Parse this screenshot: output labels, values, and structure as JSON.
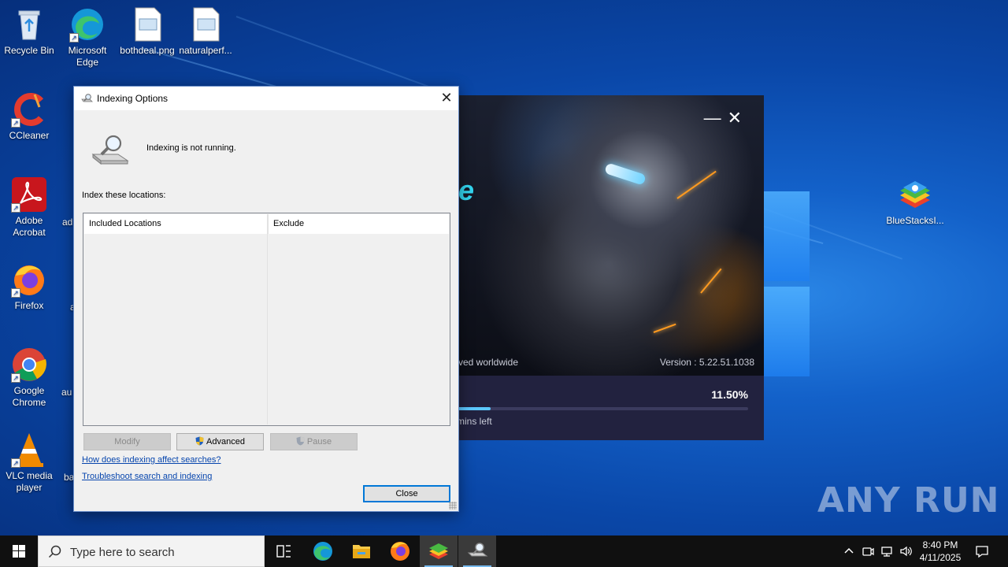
{
  "desktop": {
    "icons": [
      {
        "label": "Recycle Bin"
      },
      {
        "label": "Microsoft Edge"
      },
      {
        "label": "bothdeal.png"
      },
      {
        "label": "naturalperf..."
      },
      {
        "label": "CCleaner"
      },
      {
        "label": "Adobe Acrobat"
      },
      {
        "label": "Firefox"
      },
      {
        "label": "Google Chrome"
      },
      {
        "label": "VLC media player"
      },
      {
        "label": "BlueStacksI..."
      }
    ],
    "partial_labels": [
      "ad",
      "a",
      "au",
      "ba"
    ]
  },
  "bluestacks": {
    "rights_text": "rved worldwide",
    "version_text": "Version : 5.22.51.1038",
    "progress_text": "11.50%",
    "progress_value": 11.5,
    "time_left_text": "mins left",
    "logo_fragment": "e",
    "controls": {
      "minimize": "—",
      "close": "✕"
    }
  },
  "dialog": {
    "title": "Indexing Options",
    "status": "Indexing is not running.",
    "locations_label": "Index these locations:",
    "columns": [
      "Included Locations",
      "Exclude"
    ],
    "rows": [],
    "buttons": {
      "modify": "Modify",
      "advanced": "Advanced",
      "pause": "Pause",
      "close": "Close"
    },
    "links": {
      "how": "How does indexing affect searches?",
      "troubleshoot": "Troubleshoot search and indexing"
    }
  },
  "watermark": "ANY RUN",
  "taskbar": {
    "search_placeholder": "Type here to search",
    "apps": [
      "task-view",
      "edge",
      "file-explorer",
      "firefox",
      "bluestacks",
      "indexing-options"
    ],
    "time": "8:40 PM",
    "date": "4/11/2025"
  },
  "colors": {
    "accent": "#0078d7",
    "link": "#0645ad",
    "progress": "#5cc8ff"
  }
}
